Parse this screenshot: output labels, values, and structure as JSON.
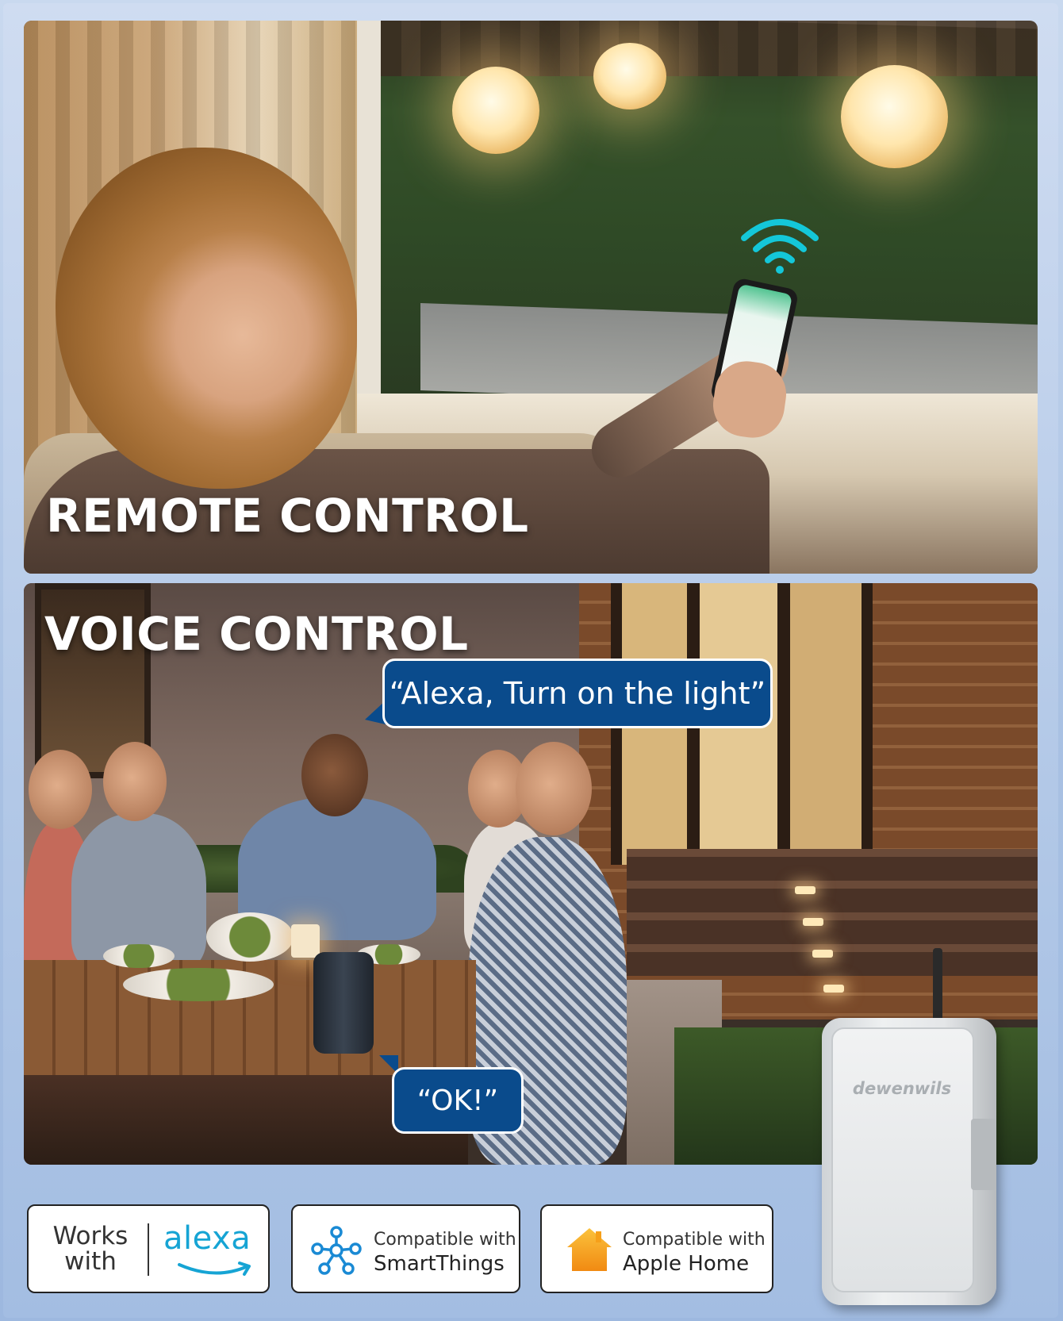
{
  "sections": {
    "remote": {
      "heading": "REMOTE CONTROL"
    },
    "voice": {
      "heading": "VOICE CONTROL",
      "speech_bubble_command": "“Alexa, Turn on the light”",
      "speech_bubble_reply": "“OK!”"
    }
  },
  "device": {
    "brand": "dewenwils"
  },
  "badges": {
    "alexa": {
      "works": "Works",
      "with": "with",
      "logo_text": "alexa"
    },
    "smartthings": {
      "line1": "Compatible with",
      "line2": "SmartThings"
    },
    "apple_home": {
      "line1": "Compatible with",
      "line2": "Apple Home"
    }
  },
  "icons": {
    "wifi": "wifi-signal-icon",
    "smartthings": "smartthings-icon",
    "home": "home-icon",
    "alexa_smile": "amazon-smile-icon"
  },
  "colors": {
    "bubble_blue": "#0a4b8c",
    "alexa_blue": "#16a4d4",
    "home_orange": "#f6a01a",
    "wifi_teal": "#14c7d9"
  }
}
